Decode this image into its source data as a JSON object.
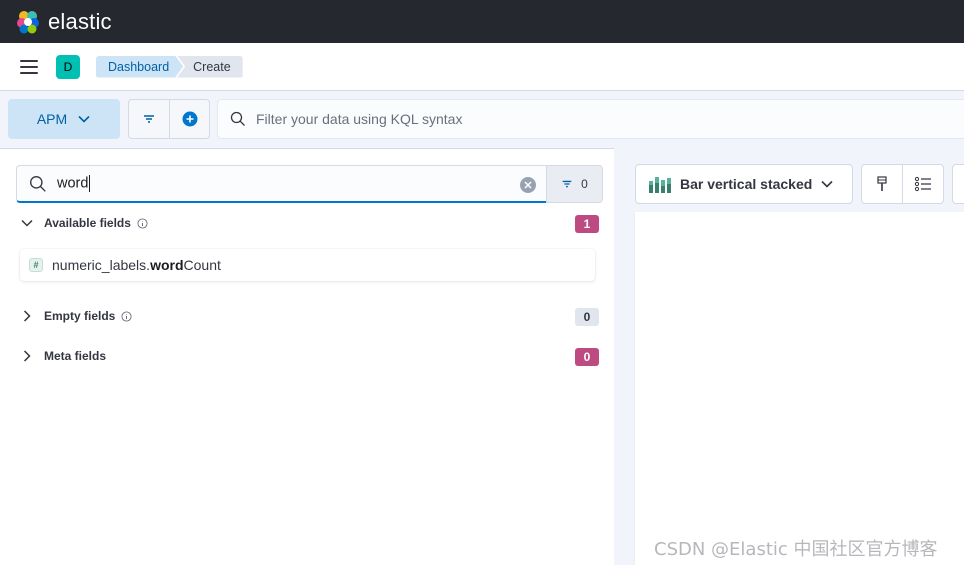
{
  "topbar": {
    "brand": "elastic"
  },
  "header": {
    "space_initial": "D",
    "breadcrumbs": [
      {
        "label": "Dashboard"
      },
      {
        "label": "Create"
      }
    ]
  },
  "querybar": {
    "data_view_label": "APM",
    "kql_placeholder": "Filter your data using KQL syntax"
  },
  "field_list": {
    "search_value": "word",
    "filter_count": "0",
    "sections": [
      {
        "label": "Available fields",
        "count": "1"
      },
      {
        "label": "Empty fields",
        "count": "0"
      },
      {
        "label": "Meta fields",
        "count": "0"
      }
    ],
    "fields": [
      {
        "type_symbol": "#",
        "name_prefix": "numeric_labels.",
        "name_match": "word",
        "name_suffix": "Count"
      }
    ]
  },
  "workspace": {
    "chart_type_label": "Bar vertical stacked"
  },
  "watermark": "CSDN @Elastic 中国社区官方博客",
  "colors": {
    "accent": "#0077cc",
    "badge_pink": "#bd4b81",
    "topbar": "#25282f"
  }
}
